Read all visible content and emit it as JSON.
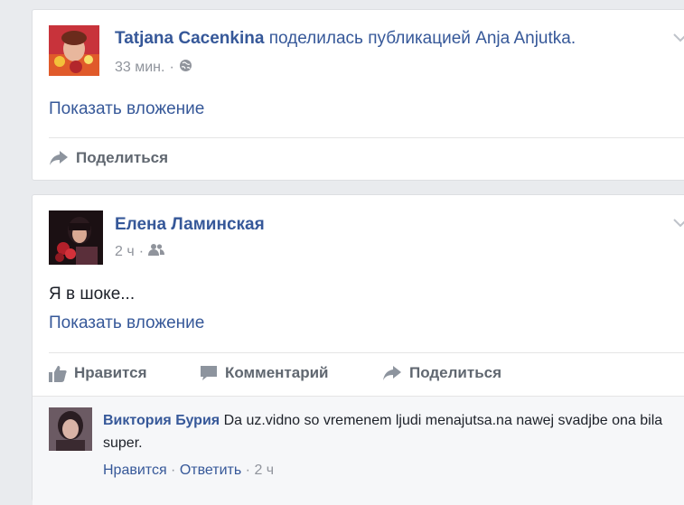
{
  "post1": {
    "author": "Tatjana Cacenkina",
    "action_text": "поделилась публикацией Anja Anjutka.",
    "time": "33 мин.",
    "separator": "·",
    "privacy_icon": "globe-icon",
    "attachment_link": "Показать вложение",
    "share_label": "Поделиться"
  },
  "post2": {
    "author": "Елена Ламинская",
    "time": "2 ч",
    "separator": "·",
    "privacy_icon": "friends-icon",
    "text": "Я в шоке...",
    "attachment_link": "Показать вложение",
    "like_label": "Нравится",
    "comment_label": "Комментарий",
    "share_label": "Поделиться"
  },
  "comment": {
    "author": "Виктория Бурия",
    "text": "Da uz.vidno so vremenem ljudi menajutsa.na nawej svadjbe ona bila super.",
    "like_label": "Нравится",
    "sep": " · ",
    "reply_label": "Ответить",
    "time": "2 ч"
  },
  "colors": {
    "link": "#365899",
    "muted": "#90949c",
    "action": "#606770",
    "background": "#e9ebee"
  }
}
